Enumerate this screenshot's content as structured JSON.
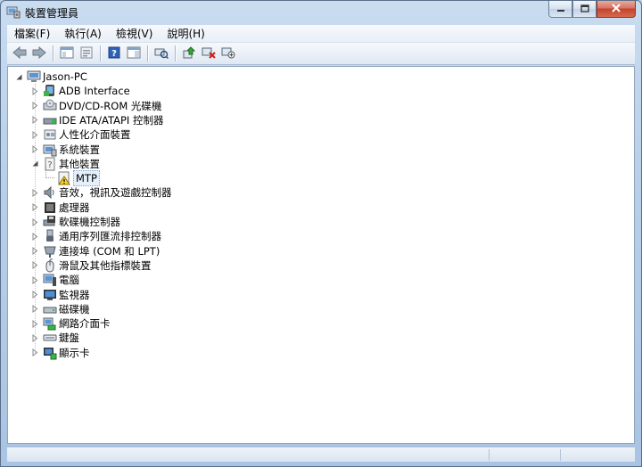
{
  "window": {
    "title": "裝置管理員",
    "app_icon": "device-manager-icon"
  },
  "caption": {
    "minimize": "minimize-icon",
    "maximize": "maximize-icon",
    "close": "close-icon"
  },
  "menu": [
    {
      "label": "檔案(F)"
    },
    {
      "label": "執行(A)"
    },
    {
      "label": "檢視(V)"
    },
    {
      "label": "說明(H)"
    }
  ],
  "toolbar": [
    {
      "icon": "back-arrow-icon"
    },
    {
      "icon": "forward-arrow-icon"
    },
    {
      "icon": "show-hide-console-tree-icon"
    },
    {
      "icon": "properties-icon"
    },
    {
      "icon": "help-icon"
    },
    {
      "icon": "action-pane-icon"
    },
    {
      "icon": "scan-hardware-icon"
    },
    {
      "icon": "update-driver-icon"
    },
    {
      "icon": "uninstall-device-icon"
    },
    {
      "icon": "disable-device-icon"
    }
  ],
  "tree": {
    "root": {
      "label": "Jason-PC",
      "icon": "computer-icon"
    },
    "categories": [
      {
        "label": "ADB Interface",
        "icon": "adb-device-icon",
        "expanded": false
      },
      {
        "label": "DVD/CD-ROM 光碟機",
        "icon": "optical-drive-icon",
        "expanded": false
      },
      {
        "label": "IDE ATA/ATAPI 控制器",
        "icon": "ide-controller-icon",
        "expanded": false
      },
      {
        "label": "人性化介面裝置",
        "icon": "hid-icon",
        "expanded": false
      },
      {
        "label": "系統裝置",
        "icon": "system-device-icon",
        "expanded": false
      },
      {
        "label": "其他裝置",
        "icon": "other-device-icon",
        "expanded": true,
        "children": [
          {
            "label": "MTP",
            "icon": "warning-device-icon"
          }
        ]
      },
      {
        "label": "音效，視訊及遊戲控制器",
        "icon": "sound-icon",
        "expanded": false
      },
      {
        "label": "處理器",
        "icon": "processor-icon",
        "expanded": false
      },
      {
        "label": "軟碟機控制器",
        "icon": "floppy-controller-icon",
        "expanded": false
      },
      {
        "label": "通用序列匯流排控制器",
        "icon": "usb-icon",
        "expanded": false
      },
      {
        "label": "連接埠 (COM 和 LPT)",
        "icon": "port-icon",
        "expanded": false
      },
      {
        "label": "滑鼠及其他指標裝置",
        "icon": "mouse-icon",
        "expanded": false
      },
      {
        "label": "電腦",
        "icon": "pc-icon",
        "expanded": false
      },
      {
        "label": "監視器",
        "icon": "monitor-icon",
        "expanded": false
      },
      {
        "label": "磁碟機",
        "icon": "disk-drive-icon",
        "expanded": false
      },
      {
        "label": "網路介面卡",
        "icon": "network-adapter-icon",
        "expanded": false
      },
      {
        "label": "鍵盤",
        "icon": "keyboard-icon",
        "expanded": false
      },
      {
        "label": "顯示卡",
        "icon": "display-adapter-icon",
        "expanded": false
      }
    ]
  }
}
